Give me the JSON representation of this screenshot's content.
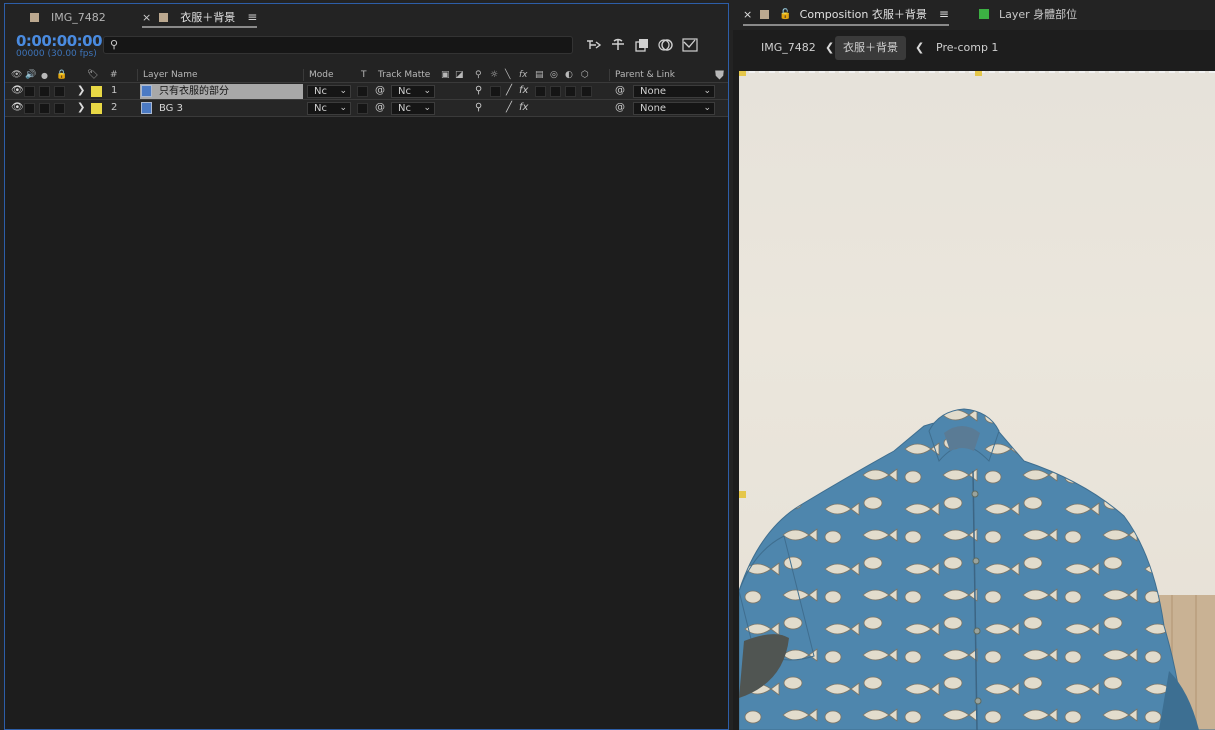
{
  "timeline": {
    "tabs": [
      {
        "label": "IMG_7482",
        "color": "#bba88f"
      },
      {
        "label": "衣服＋背景",
        "color": "#bba88f",
        "close": "×",
        "menu": "≡"
      }
    ],
    "timecode": "0:00:00:00",
    "frame_info": "00000 (30.00 fps)",
    "search": {
      "placeholder": ""
    },
    "columns": {
      "number": "#",
      "layer_name": "Layer Name",
      "mode": "Mode",
      "t": "T",
      "track_matte": "Track Matte",
      "parent_link": "Parent & Link"
    },
    "layers": [
      {
        "number": "1",
        "name": "只有衣服的部分",
        "mode": "Nc",
        "track_matte": "Nc",
        "parent": "None",
        "label_color": "#e8d845",
        "selected": true
      },
      {
        "number": "2",
        "name": "BG 3",
        "mode": "Nc",
        "track_matte": "Nc",
        "parent": "None",
        "label_color": "#e8d845",
        "selected": false
      }
    ],
    "switch_fx": "fx"
  },
  "composition": {
    "tab_close": "×",
    "tab_label": "Composition 衣服＋背景",
    "tab_menu": "≡",
    "layer_tab_label": "Layer 身體部位",
    "layer_tab_color": "#3cb043",
    "breadcrumbs": [
      "IMG_7482",
      "衣服＋背景",
      "Pre-comp 1"
    ],
    "handle_color": "#e5c74a"
  },
  "colors": {
    "accent_blue": "#4a8be0",
    "panel_border": "#2d5ea8",
    "selected_row": "#a8a8a8"
  }
}
